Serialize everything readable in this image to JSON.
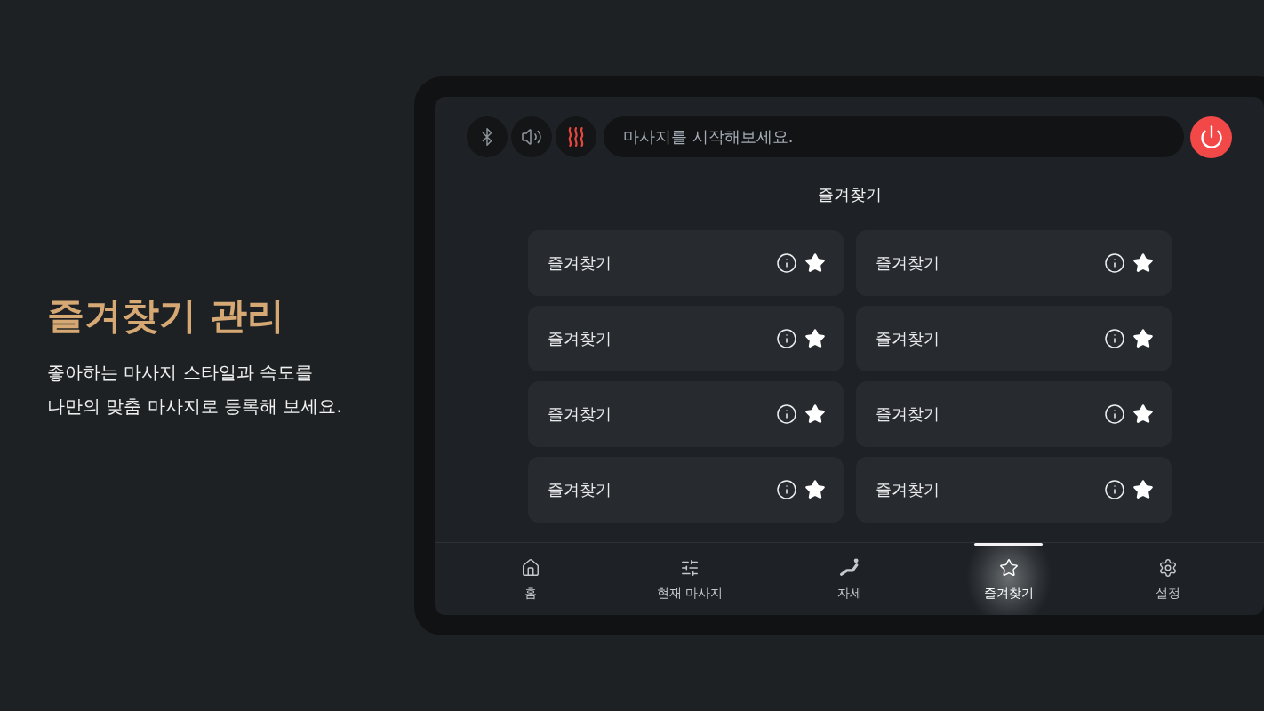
{
  "intro": {
    "title": "즐겨찾기 관리",
    "description": "좋아하는 마사지 스타일과 속도를\n나만의 맞춤 마사지로 등록해 보세요."
  },
  "top_bar": {
    "toggles": [
      {
        "on": false
      },
      {
        "on": false
      },
      {
        "on": true
      }
    ],
    "message": "마사지를 시작해보세요."
  },
  "page_title": "즐겨찾기",
  "favorites": [
    {
      "name": "즐겨찾기",
      "starred": true
    },
    {
      "name": "즐겨찾기",
      "starred": true
    },
    {
      "name": "즐겨찾기",
      "starred": true
    },
    {
      "name": "즐겨찾기",
      "starred": true
    },
    {
      "name": "즐겨찾기",
      "starred": true
    },
    {
      "name": "즐겨찾기",
      "starred": true
    },
    {
      "name": "즐겨찾기",
      "starred": true
    },
    {
      "name": "즐겨찾기",
      "starred": true
    }
  ],
  "nav": [
    {
      "label": "홈",
      "selected": false
    },
    {
      "label": "현재 마사지",
      "selected": false
    },
    {
      "label": "자세",
      "selected": false
    },
    {
      "label": "즐겨찾기",
      "selected": true
    },
    {
      "label": "설정",
      "selected": false
    }
  ]
}
